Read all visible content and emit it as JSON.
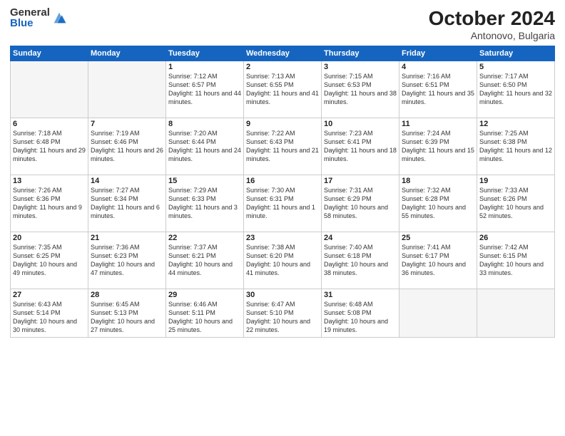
{
  "logo": {
    "general": "General",
    "blue": "Blue"
  },
  "title": "October 2024",
  "location": "Antonovo, Bulgaria",
  "headers": [
    "Sunday",
    "Monday",
    "Tuesday",
    "Wednesday",
    "Thursday",
    "Friday",
    "Saturday"
  ],
  "weeks": [
    [
      {
        "day": "",
        "info": ""
      },
      {
        "day": "",
        "info": ""
      },
      {
        "day": "1",
        "info": "Sunrise: 7:12 AM\nSunset: 6:57 PM\nDaylight: 11 hours and 44 minutes."
      },
      {
        "day": "2",
        "info": "Sunrise: 7:13 AM\nSunset: 6:55 PM\nDaylight: 11 hours and 41 minutes."
      },
      {
        "day": "3",
        "info": "Sunrise: 7:15 AM\nSunset: 6:53 PM\nDaylight: 11 hours and 38 minutes."
      },
      {
        "day": "4",
        "info": "Sunrise: 7:16 AM\nSunset: 6:51 PM\nDaylight: 11 hours and 35 minutes."
      },
      {
        "day": "5",
        "info": "Sunrise: 7:17 AM\nSunset: 6:50 PM\nDaylight: 11 hours and 32 minutes."
      }
    ],
    [
      {
        "day": "6",
        "info": "Sunrise: 7:18 AM\nSunset: 6:48 PM\nDaylight: 11 hours and 29 minutes."
      },
      {
        "day": "7",
        "info": "Sunrise: 7:19 AM\nSunset: 6:46 PM\nDaylight: 11 hours and 26 minutes."
      },
      {
        "day": "8",
        "info": "Sunrise: 7:20 AM\nSunset: 6:44 PM\nDaylight: 11 hours and 24 minutes."
      },
      {
        "day": "9",
        "info": "Sunrise: 7:22 AM\nSunset: 6:43 PM\nDaylight: 11 hours and 21 minutes."
      },
      {
        "day": "10",
        "info": "Sunrise: 7:23 AM\nSunset: 6:41 PM\nDaylight: 11 hours and 18 minutes."
      },
      {
        "day": "11",
        "info": "Sunrise: 7:24 AM\nSunset: 6:39 PM\nDaylight: 11 hours and 15 minutes."
      },
      {
        "day": "12",
        "info": "Sunrise: 7:25 AM\nSunset: 6:38 PM\nDaylight: 11 hours and 12 minutes."
      }
    ],
    [
      {
        "day": "13",
        "info": "Sunrise: 7:26 AM\nSunset: 6:36 PM\nDaylight: 11 hours and 9 minutes."
      },
      {
        "day": "14",
        "info": "Sunrise: 7:27 AM\nSunset: 6:34 PM\nDaylight: 11 hours and 6 minutes."
      },
      {
        "day": "15",
        "info": "Sunrise: 7:29 AM\nSunset: 6:33 PM\nDaylight: 11 hours and 3 minutes."
      },
      {
        "day": "16",
        "info": "Sunrise: 7:30 AM\nSunset: 6:31 PM\nDaylight: 11 hours and 1 minute."
      },
      {
        "day": "17",
        "info": "Sunrise: 7:31 AM\nSunset: 6:29 PM\nDaylight: 10 hours and 58 minutes."
      },
      {
        "day": "18",
        "info": "Sunrise: 7:32 AM\nSunset: 6:28 PM\nDaylight: 10 hours and 55 minutes."
      },
      {
        "day": "19",
        "info": "Sunrise: 7:33 AM\nSunset: 6:26 PM\nDaylight: 10 hours and 52 minutes."
      }
    ],
    [
      {
        "day": "20",
        "info": "Sunrise: 7:35 AM\nSunset: 6:25 PM\nDaylight: 10 hours and 49 minutes."
      },
      {
        "day": "21",
        "info": "Sunrise: 7:36 AM\nSunset: 6:23 PM\nDaylight: 10 hours and 47 minutes."
      },
      {
        "day": "22",
        "info": "Sunrise: 7:37 AM\nSunset: 6:21 PM\nDaylight: 10 hours and 44 minutes."
      },
      {
        "day": "23",
        "info": "Sunrise: 7:38 AM\nSunset: 6:20 PM\nDaylight: 10 hours and 41 minutes."
      },
      {
        "day": "24",
        "info": "Sunrise: 7:40 AM\nSunset: 6:18 PM\nDaylight: 10 hours and 38 minutes."
      },
      {
        "day": "25",
        "info": "Sunrise: 7:41 AM\nSunset: 6:17 PM\nDaylight: 10 hours and 36 minutes."
      },
      {
        "day": "26",
        "info": "Sunrise: 7:42 AM\nSunset: 6:15 PM\nDaylight: 10 hours and 33 minutes."
      }
    ],
    [
      {
        "day": "27",
        "info": "Sunrise: 6:43 AM\nSunset: 5:14 PM\nDaylight: 10 hours and 30 minutes."
      },
      {
        "day": "28",
        "info": "Sunrise: 6:45 AM\nSunset: 5:13 PM\nDaylight: 10 hours and 27 minutes."
      },
      {
        "day": "29",
        "info": "Sunrise: 6:46 AM\nSunset: 5:11 PM\nDaylight: 10 hours and 25 minutes."
      },
      {
        "day": "30",
        "info": "Sunrise: 6:47 AM\nSunset: 5:10 PM\nDaylight: 10 hours and 22 minutes."
      },
      {
        "day": "31",
        "info": "Sunrise: 6:48 AM\nSunset: 5:08 PM\nDaylight: 10 hours and 19 minutes."
      },
      {
        "day": "",
        "info": ""
      },
      {
        "day": "",
        "info": ""
      }
    ]
  ]
}
